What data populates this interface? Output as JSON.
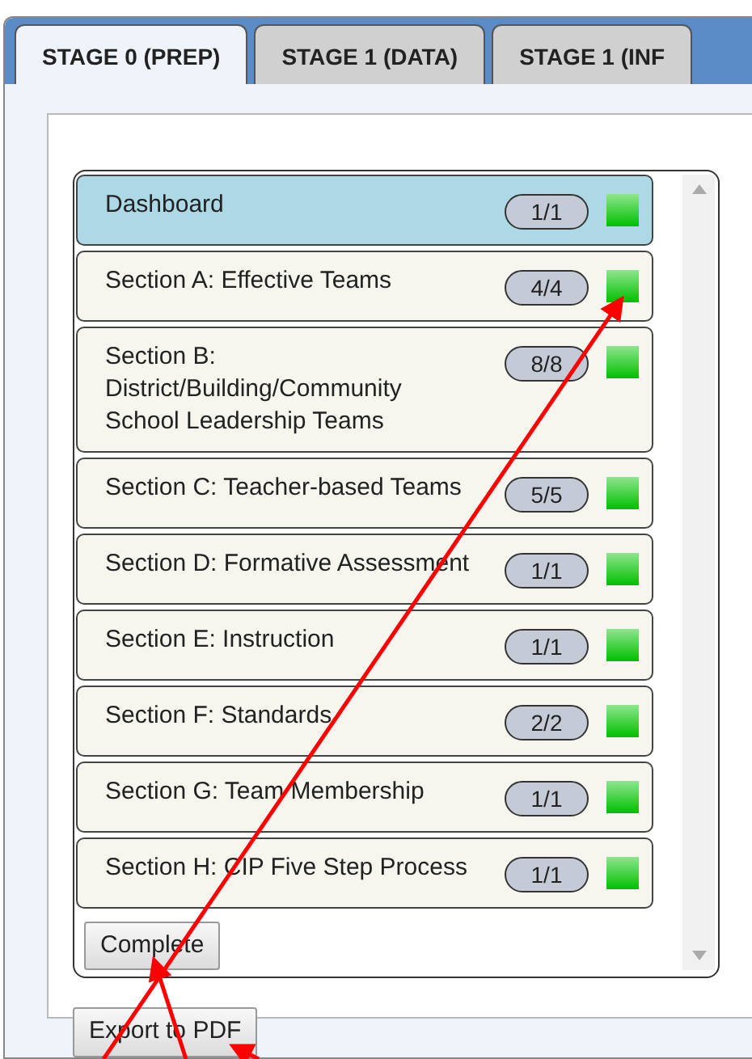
{
  "tabs": [
    {
      "label": "STAGE 0 (PREP)",
      "selected": true
    },
    {
      "label": "STAGE 1 (DATA)",
      "selected": false
    },
    {
      "label": "STAGE 1 (INF",
      "selected": false
    }
  ],
  "sections": [
    {
      "title": "Dashboard",
      "count": "1/1",
      "selected": true,
      "complete": true
    },
    {
      "title": "Section A: Effective Teams",
      "count": "4/4",
      "selected": false,
      "complete": true
    },
    {
      "title": "Section B: District/Building/Community School Leadership Teams",
      "count": "8/8",
      "selected": false,
      "complete": true
    },
    {
      "title": "Section C: Teacher-based Teams",
      "count": "5/5",
      "selected": false,
      "complete": true
    },
    {
      "title": "Section D: Formative Assessment",
      "count": "1/1",
      "selected": false,
      "complete": true
    },
    {
      "title": "Section E: Instruction",
      "count": "1/1",
      "selected": false,
      "complete": true
    },
    {
      "title": "Section F: Standards",
      "count": "2/2",
      "selected": false,
      "complete": true
    },
    {
      "title": "Section G: Team Membership",
      "count": "1/1",
      "selected": false,
      "complete": true
    },
    {
      "title": "Section H: CIP Five Step Process",
      "count": "1/1",
      "selected": false,
      "complete": true
    }
  ],
  "complete_button": "Complete",
  "export_button": "Export to PDF"
}
